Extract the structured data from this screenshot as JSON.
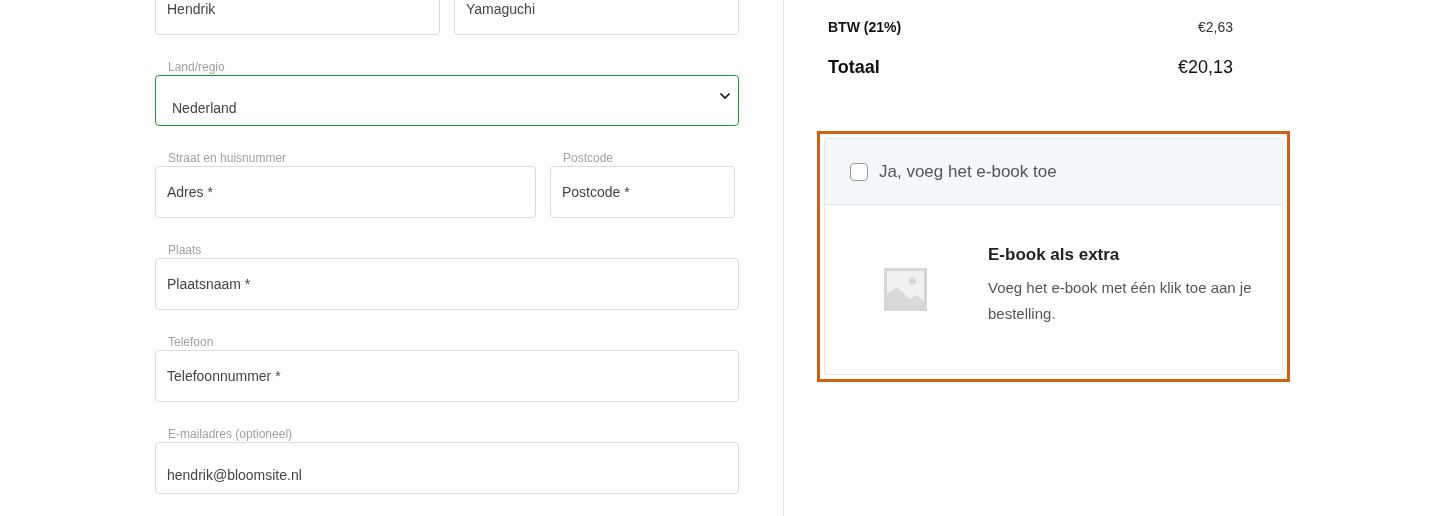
{
  "form": {
    "rows": [
      {
        "fields": [
          {
            "kind": "text",
            "value": "Hendrik",
            "focused": false
          },
          {
            "kind": "text",
            "value": "Yamaguchi",
            "focused": false
          }
        ]
      },
      {
        "fields": [
          {
            "kind": "select",
            "label": "Land/regio",
            "value": "Nederland",
            "focused": true
          }
        ]
      },
      {
        "fields": [
          {
            "kind": "text",
            "label": "Straat en huisnummer",
            "placeholder": "Adres *",
            "focused": false
          },
          {
            "kind": "text",
            "label": "Postcode",
            "placeholder": "Postcode *",
            "focused": false
          }
        ]
      },
      {
        "fields": [
          {
            "kind": "text",
            "label": "Plaats",
            "placeholder": "Plaatsnaam *",
            "focused": false
          }
        ]
      },
      {
        "fields": [
          {
            "kind": "text",
            "label": "Telefoon",
            "placeholder": "Telefoonnummer *",
            "focused": false
          }
        ]
      },
      {
        "fields": [
          {
            "kind": "text",
            "label": "E-mailadres (optioneel)",
            "value": "hendrik@bloomsite.nl",
            "focused": false
          }
        ]
      }
    ]
  },
  "summary": {
    "rows": [
      {
        "kind": "line",
        "label": "BTW (21%)",
        "value": "€2,63"
      },
      {
        "kind": "total",
        "label": "Totaal",
        "value": "€20,13"
      }
    ]
  },
  "upsell": {
    "checkbox": {
      "label": "Ja, voeg het e-book toe",
      "checked": false
    },
    "title": "E-book als extra",
    "description": "Voeg het e-book met één klik toe aan je bestelling."
  }
}
